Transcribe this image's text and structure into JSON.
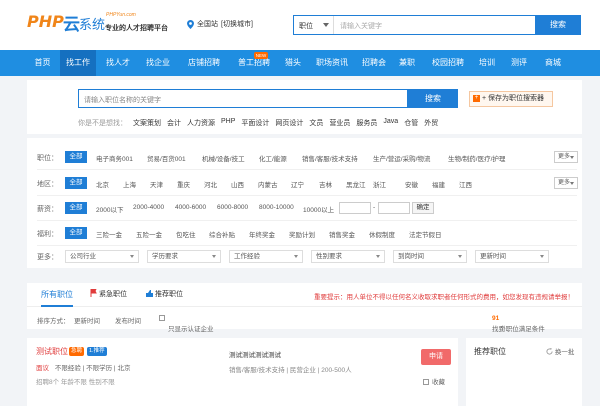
{
  "header": {
    "logo_php": "PHP",
    "logo_yun": "云",
    "logo_sys": "系统",
    "logo_domain": "PHPYun.com",
    "slogan": "专业的人才招聘平台",
    "site_label": "全国站",
    "switch_label": "[切换城市]",
    "search_select": "职位",
    "search_placeholder": "请输入关键字",
    "search_button": "搜索"
  },
  "nav": {
    "items": [
      "首页",
      "找工作",
      "找人才",
      "找企业",
      "店铺招聘",
      "普工招聘",
      "猎头",
      "职场资讯",
      "招聘会",
      "兼职",
      "校园招聘",
      "培训",
      "测评",
      "商城"
    ],
    "active": "找工作",
    "new_badge": "NEW"
  },
  "search2": {
    "placeholder": "请输入职位名称的关键字",
    "button": "搜索",
    "save": "+ 保存为职位搜索器",
    "hot_label": "你是不是想找：",
    "hot": [
      "文案策划",
      "会计",
      "人力资源",
      "PHP",
      "平面设计",
      "网页设计",
      "文员",
      "营业员",
      "服务员",
      "Java",
      "仓管",
      "外贸"
    ]
  },
  "filters": {
    "all_label": "全部",
    "more_label": "更多",
    "job": {
      "label": "职位：",
      "options": [
        "电子商务001",
        "贸易/百货001",
        "机械/设备/技工",
        "化工/能源",
        "销售/客服/技术支持",
        "生产/营运/采购/物流",
        "生物/制药/医疗/护理"
      ]
    },
    "city": {
      "label": "地区：",
      "options": [
        "北京",
        "上海",
        "天津",
        "重庆",
        "河北",
        "山西",
        "内蒙古",
        "辽宁",
        "吉林",
        "黑龙江",
        "浙江",
        "安徽",
        "福建",
        "江西"
      ]
    },
    "salary": {
      "label": "薪资：",
      "options": [
        "2000以下",
        "2000-4000",
        "4000-6000",
        "6000-8000",
        "8000-10000",
        "10000以上"
      ],
      "dash": "-",
      "confirm": "确定"
    },
    "welfare": {
      "label": "福利：",
      "options": [
        "三险一金",
        "五险一金",
        "包吃住",
        "综合补贴",
        "年终奖金",
        "奖励计划",
        "销售奖金",
        "休假制度",
        "法定节假日"
      ]
    },
    "more": {
      "label": "更多：",
      "selects": [
        "公司行业",
        "学历要求",
        "工作经验",
        "性别要求",
        "到岗时间",
        "更新时间"
      ]
    }
  },
  "tabs": {
    "all": "所有职位",
    "urgent": "紧急职位",
    "recommend": "推荐职位",
    "tip": "重要提示：用人单位不得以任何名义收取求职者任何形式的费用，如您发现有违规请举报！"
  },
  "sortbar": {
    "label": "排序方式：",
    "update": "更新时间",
    "publish": "发布时间",
    "cert": "只显示认证企业",
    "found_prefix": "找到",
    "found_count": "91",
    "found_suffix": "个职位满足条件"
  },
  "job": {
    "title": "测试职位",
    "tag1": "急聘",
    "tag2": "1.推荐",
    "salary": "面议",
    "exp": "不限经验",
    "edu": "不限学历",
    "city": "北京",
    "time": "招聘8个  年龄不限  性别不限",
    "company": "测试测试测试测试",
    "company_info": "销售/客服/技术支持 | 民营企业 | 200-500人",
    "apply": "申请",
    "fav": "收藏"
  },
  "side": {
    "title": "推荐职位",
    "refresh": "换一批"
  },
  "colors": {
    "primary": "#1f7ed6",
    "nav": "#1f8ee1",
    "accent": "#ff6a00",
    "red": "#e03b3b"
  }
}
